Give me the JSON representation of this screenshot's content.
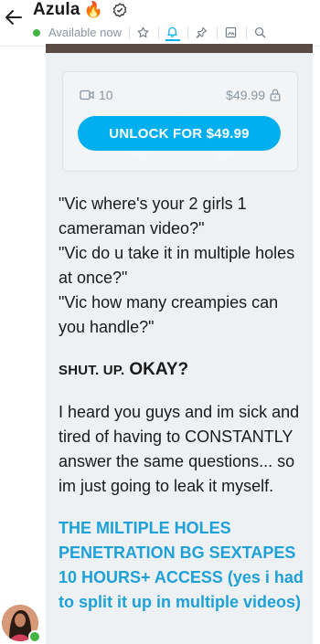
{
  "header": {
    "name": "Azula",
    "name_emoji": "🔥",
    "status": "Available now",
    "icons": [
      "back-arrow-icon",
      "verified-icon",
      "star-icon",
      "bell-icon",
      "pin-icon",
      "image-icon",
      "search-icon"
    ]
  },
  "locked_post": {
    "video_count": "10",
    "price": "$49.99",
    "unlock_label": "UNLOCK FOR $49.99"
  },
  "message": {
    "quotes": [
      "\"Vic where's your 2 girls 1 cameraman video?\"",
      "\"Vic do u take it in multiple holes at once?\"",
      "\"Vic how many creampies can you handle?\""
    ],
    "shut_part1": "SHUT. UP.",
    "shut_part2": "OKAY?",
    "body": "I heard you guys and im sick and tired of having to CONSTANTLY answer the same questions... so im just going to leak it myself.",
    "link_text": "THE MILTIPLE HOLES PENETRATION BG SEXTAPES 10 HOURS+ ACCESS (yes i had to split it up in multiple videos)"
  },
  "colors": {
    "accent": "#00aff0",
    "link": "#1ea0d8",
    "online": "#44b544",
    "muted": "#8a96a3",
    "bubble": "#eef1f4"
  }
}
